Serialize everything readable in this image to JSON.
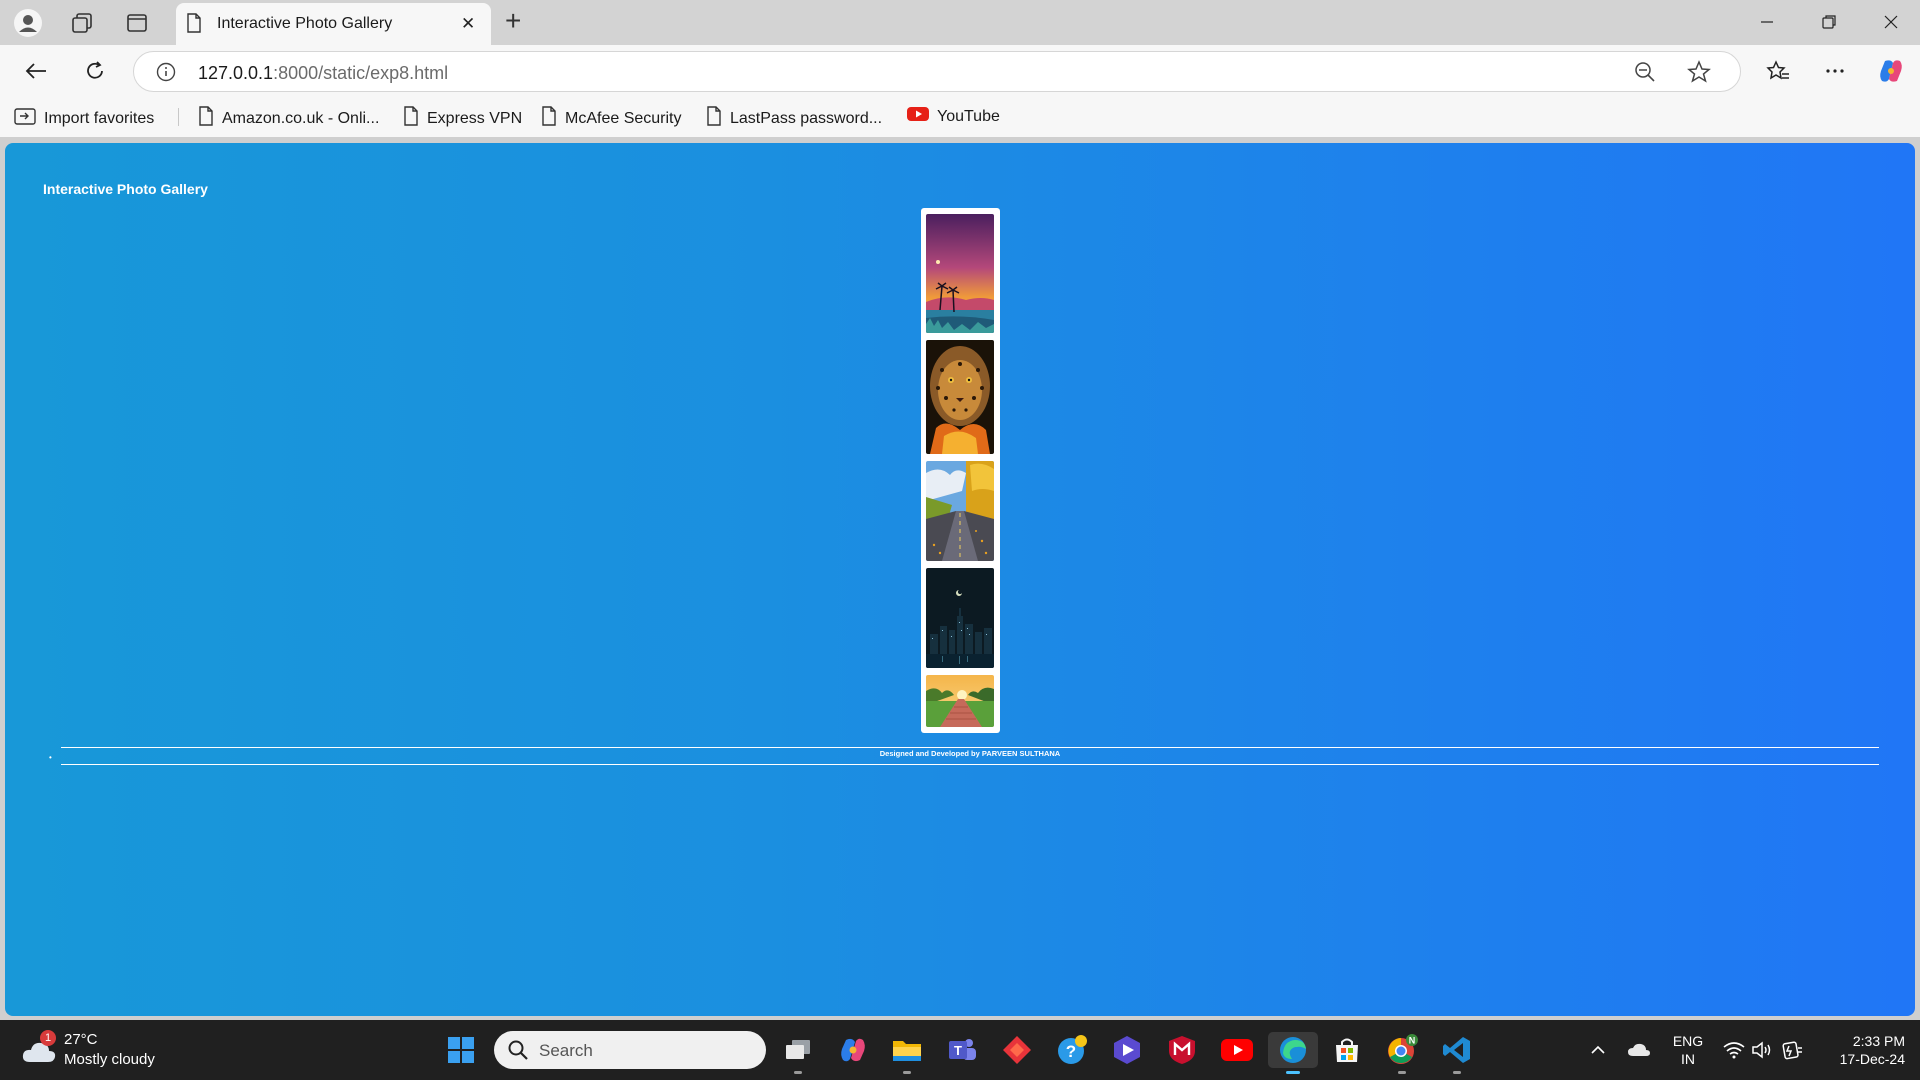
{
  "browser": {
    "tab_title": "Interactive Photo Gallery",
    "url_host": "127.0.0.1",
    "url_rest": ":8000/static/exp8.html"
  },
  "favorites": [
    {
      "label": "Import favorites",
      "icon": "import-favorites-icon"
    },
    {
      "label": "Amazon.co.uk - Onli...",
      "icon": "page-icon"
    },
    {
      "label": "Express VPN",
      "icon": "page-icon"
    },
    {
      "label": "McAfee Security",
      "icon": "page-icon"
    },
    {
      "label": "LastPass password...",
      "icon": "page-icon"
    },
    {
      "label": "YouTube",
      "icon": "youtube-icon"
    }
  ],
  "page": {
    "heading": "Interactive Photo Gallery",
    "footer_bullet": "•",
    "credit": "Designed and Developed by PARVEEN SULTHANA",
    "photos": [
      {
        "name": "sunset-palms-photo",
        "colors": [
          "#5a2a6a",
          "#e8843a",
          "#2a7a9a"
        ]
      },
      {
        "name": "leopard-photo",
        "colors": [
          "#3a2a18",
          "#c8782a",
          "#1a1008"
        ]
      },
      {
        "name": "autumn-road-photo",
        "colors": [
          "#5aa0d8",
          "#e0a020",
          "#3a3a3a"
        ]
      },
      {
        "name": "night-city-photo",
        "colors": [
          "#0a1a22",
          "#1a3a4a",
          "#4a6a7a"
        ]
      },
      {
        "name": "sunrise-boardwalk-photo",
        "colors": [
          "#f0a030",
          "#3a8a3a",
          "#c06060"
        ]
      }
    ]
  },
  "taskbar": {
    "weather_badge": "1",
    "temperature": "27°C",
    "condition": "Mostly cloudy",
    "search_placeholder": "Search",
    "lang_line1": "ENG",
    "lang_line2": "IN",
    "time": "2:33 PM",
    "date": "17-Dec-24"
  }
}
